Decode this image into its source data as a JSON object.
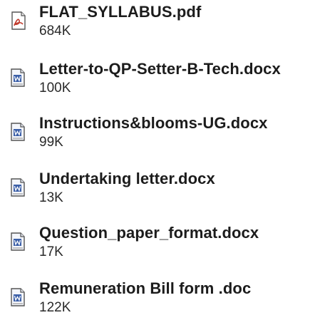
{
  "files": [
    {
      "name": "FLAT_SYLLABUS.pdf",
      "size": "684K",
      "icon": "pdf-file-icon"
    },
    {
      "name": "Letter-to-QP-Setter-B-Tech.docx",
      "size": "100K",
      "icon": "word-document-icon"
    },
    {
      "name": "Instructions&blooms-UG.docx",
      "size": "99K",
      "icon": "word-document-icon"
    },
    {
      "name": "Undertaking letter.docx",
      "size": "13K",
      "icon": "word-document-icon"
    },
    {
      "name": "Question_paper_format.docx",
      "size": "17K",
      "icon": "word-document-icon"
    },
    {
      "name": "Remuneration Bill form .doc",
      "size": "122K",
      "icon": "word-document-icon"
    }
  ],
  "colors": {
    "text": "#1c1c1c",
    "word_icon_accent": "#3b5fa8",
    "pdf_icon_accent": "#c0392b"
  }
}
